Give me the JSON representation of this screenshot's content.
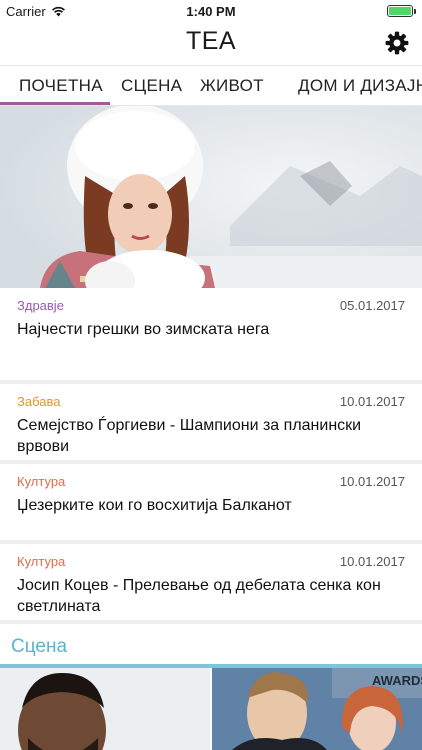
{
  "status": {
    "carrier": "Carrier",
    "time": "1:40 PM",
    "battery_level": 1.0
  },
  "header": {
    "title": "TEA",
    "settings_icon": "gear-icon"
  },
  "tabs": [
    {
      "label": "ПОЧЕТНА",
      "active": true
    },
    {
      "label": "СЦЕНА",
      "active": false
    },
    {
      "label": "ЖИВОТ",
      "active": false
    },
    {
      "label": "ДОМ И ДИЗАЈН",
      "active": false
    }
  ],
  "colors": {
    "active_tab": "#a25a9f",
    "scena": "#5ab6cf",
    "zdravje": "#9b59b6",
    "zabava": "#e0962a",
    "kultura": "#e06a4c"
  },
  "articles": [
    {
      "category": "Здравје",
      "date": "05.01.2017",
      "title": "Најчести грешки во зимската нега"
    },
    {
      "category": "Забава",
      "date": "10.01.2017",
      "title": "Семејство Ѓоргиеви - Шампиони за планински врвови"
    },
    {
      "category": "Култура",
      "date": "10.01.2017",
      "title": "Џезерките кои го восхитија Балканот"
    },
    {
      "category": "Култура",
      "date": "10.01.2017",
      "title": "Јосип Коцев - Прелевање од дебелата сенка кон светлината"
    }
  ],
  "section": {
    "title": "Сцена"
  },
  "thumb_text": {
    "awards": "AWARDS"
  }
}
